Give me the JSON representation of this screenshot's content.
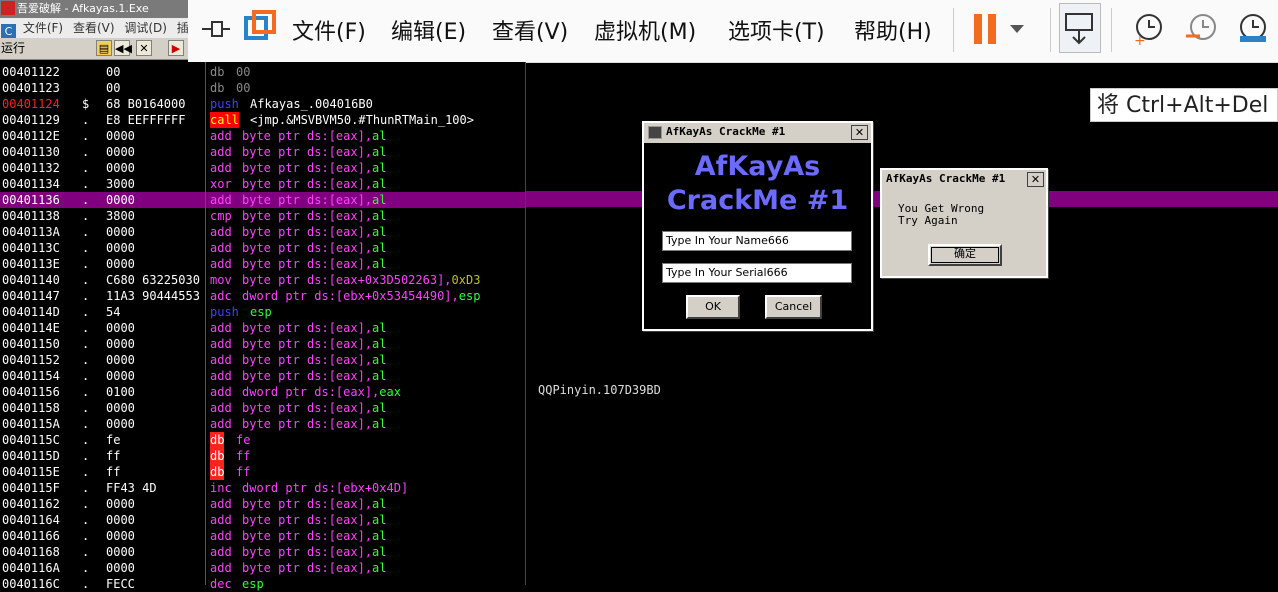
{
  "olly": {
    "title": "吾爱破解 - Afkayas.1.Exe",
    "menu": [
      "文件(F)",
      "查看(V)",
      "调试(D)",
      "插"
    ],
    "menu_icon": "C",
    "status": "运行"
  },
  "vmware": {
    "menus": [
      "文件(F)",
      "编辑(E)",
      "查看(V)",
      "虚拟机(M)",
      "选项卡(T)",
      "帮助(H)"
    ],
    "ctrl_hint": "将 Ctrl+Alt+Del",
    "accent": "#f36b21"
  },
  "disasm": [
    {
      "addr": "00401122",
      "mark": "",
      "hex": "00",
      "op": "db",
      "args": "00",
      "opc": "db",
      "argc": "grey"
    },
    {
      "addr": "00401123",
      "mark": "",
      "hex": "00",
      "op": "db",
      "args": "00",
      "opc": "db",
      "argc": "grey"
    },
    {
      "addr": "00401124",
      "mark": "$",
      "hex": "68 B0164000",
      "op": "push",
      "args": "Afkayas_.004016B0",
      "opc": "push",
      "argc": "white",
      "red": true
    },
    {
      "addr": "00401129",
      "mark": ".",
      "hex": "E8 EEFFFFFF",
      "op": "call",
      "args": "<jmp.&MSVBVM50.#ThunRTMain_100>",
      "opc": "call",
      "argc": "white"
    },
    {
      "addr": "0040112E",
      "mark": ".",
      "hex": "0000",
      "op": "add",
      "args": "byte ptr ds:[eax],al",
      "opc": "add",
      "argc": "normal"
    },
    {
      "addr": "00401130",
      "mark": ".",
      "hex": "0000",
      "op": "add",
      "args": "byte ptr ds:[eax],al",
      "opc": "add",
      "argc": "normal"
    },
    {
      "addr": "00401132",
      "mark": ".",
      "hex": "0000",
      "op": "add",
      "args": "byte ptr ds:[eax],al",
      "opc": "add",
      "argc": "normal"
    },
    {
      "addr": "00401134",
      "mark": ".",
      "hex": "3000",
      "op": "xor",
      "args": "byte ptr ds:[eax],al",
      "opc": "xor",
      "argc": "normal"
    },
    {
      "addr": "00401136",
      "mark": ".",
      "hex": "0000",
      "op": "add",
      "args": "byte ptr ds:[eax],al",
      "opc": "add",
      "argc": "normal",
      "hl": true
    },
    {
      "addr": "00401138",
      "mark": ".",
      "hex": "3800",
      "op": "cmp",
      "args": "byte ptr ds:[eax],al",
      "opc": "cmp",
      "argc": "normal"
    },
    {
      "addr": "0040113A",
      "mark": ".",
      "hex": "0000",
      "op": "add",
      "args": "byte ptr ds:[eax],al",
      "opc": "add",
      "argc": "normal"
    },
    {
      "addr": "0040113C",
      "mark": ".",
      "hex": "0000",
      "op": "add",
      "args": "byte ptr ds:[eax],al",
      "opc": "add",
      "argc": "normal"
    },
    {
      "addr": "0040113E",
      "mark": ".",
      "hex": "0000",
      "op": "add",
      "args": "byte ptr ds:[eax],al",
      "opc": "add",
      "argc": "normal"
    },
    {
      "addr": "00401140",
      "mark": ".",
      "hex": "C680 63225030",
      "op": "mov",
      "args": "byte ptr ds:[eax+0x3D502263],0xD3",
      "opc": "mov",
      "argc": "normal"
    },
    {
      "addr": "00401147",
      "mark": ".",
      "hex": "11A3 90444553",
      "op": "adc",
      "args": "dword ptr ds:[ebx+0x53454490],esp",
      "opc": "adc",
      "argc": "normal"
    },
    {
      "addr": "0040114D",
      "mark": ".",
      "hex": "54",
      "op": "push",
      "args": "esp",
      "opc": "push",
      "argc": "reg"
    },
    {
      "addr": "0040114E",
      "mark": ".",
      "hex": "0000",
      "op": "add",
      "args": "byte ptr ds:[eax],al",
      "opc": "add",
      "argc": "normal"
    },
    {
      "addr": "00401150",
      "mark": ".",
      "hex": "0000",
      "op": "add",
      "args": "byte ptr ds:[eax],al",
      "opc": "add",
      "argc": "normal"
    },
    {
      "addr": "00401152",
      "mark": ".",
      "hex": "0000",
      "op": "add",
      "args": "byte ptr ds:[eax],al",
      "opc": "add",
      "argc": "normal"
    },
    {
      "addr": "00401154",
      "mark": ".",
      "hex": "0000",
      "op": "add",
      "args": "byte ptr ds:[eax],al",
      "opc": "add",
      "argc": "normal"
    },
    {
      "addr": "00401156",
      "mark": ".",
      "hex": "0100",
      "op": "add",
      "args": "dword ptr ds:[eax],eax",
      "opc": "add",
      "argc": "normal"
    },
    {
      "addr": "00401158",
      "mark": ".",
      "hex": "0000",
      "op": "add",
      "args": "byte ptr ds:[eax],al",
      "opc": "add",
      "argc": "normal"
    },
    {
      "addr": "0040115A",
      "mark": ".",
      "hex": "0000",
      "op": "add",
      "args": "byte ptr ds:[eax],al",
      "opc": "add",
      "argc": "normal"
    },
    {
      "addr": "0040115C",
      "mark": ".",
      "hex": "fe",
      "op": "db",
      "args": "fe",
      "opc": "dbr",
      "argc": "normal"
    },
    {
      "addr": "0040115D",
      "mark": ".",
      "hex": "ff",
      "op": "db",
      "args": "ff",
      "opc": "dbr",
      "argc": "normal"
    },
    {
      "addr": "0040115E",
      "mark": ".",
      "hex": "ff",
      "op": "db",
      "args": "ff",
      "opc": "dbr",
      "argc": "normal"
    },
    {
      "addr": "0040115F",
      "mark": ".",
      "hex": "FF43 4D",
      "op": "inc",
      "args": "dword ptr ds:[ebx+0x4D]",
      "opc": "inc",
      "argc": "normal"
    },
    {
      "addr": "00401162",
      "mark": ".",
      "hex": "0000",
      "op": "add",
      "args": "byte ptr ds:[eax],al",
      "opc": "add",
      "argc": "normal"
    },
    {
      "addr": "00401164",
      "mark": ".",
      "hex": "0000",
      "op": "add",
      "args": "byte ptr ds:[eax],al",
      "opc": "add",
      "argc": "normal"
    },
    {
      "addr": "00401166",
      "mark": ".",
      "hex": "0000",
      "op": "add",
      "args": "byte ptr ds:[eax],al",
      "opc": "add",
      "argc": "normal"
    },
    {
      "addr": "00401168",
      "mark": ".",
      "hex": "0000",
      "op": "add",
      "args": "byte ptr ds:[eax],al",
      "opc": "add",
      "argc": "normal"
    },
    {
      "addr": "0040116A",
      "mark": ".",
      "hex": "0000",
      "op": "add",
      "args": "byte ptr ds:[eax],al",
      "opc": "add",
      "argc": "normal"
    },
    {
      "addr": "0040116C",
      "mark": ".",
      "hex": "FECC",
      "op": "dec",
      "args": "esp",
      "opc": "dec",
      "argc": "reg"
    }
  ],
  "side_label": "QQPinyin.107D39BD",
  "crackme": {
    "window_title": "AfKayAs CrackMe #1",
    "title_line1": "AfKayAs",
    "title_line2": "CrackMe #1",
    "name_value": "Type In Your Name666",
    "serial_value": "Type In Your Serial666",
    "ok_label": "OK",
    "cancel_label": "Cancel"
  },
  "msgbox": {
    "window_title": "AfKayAs CrackMe #1",
    "line1": "You Get Wrong",
    "line2": "Try Again",
    "ok_label": "确定"
  }
}
